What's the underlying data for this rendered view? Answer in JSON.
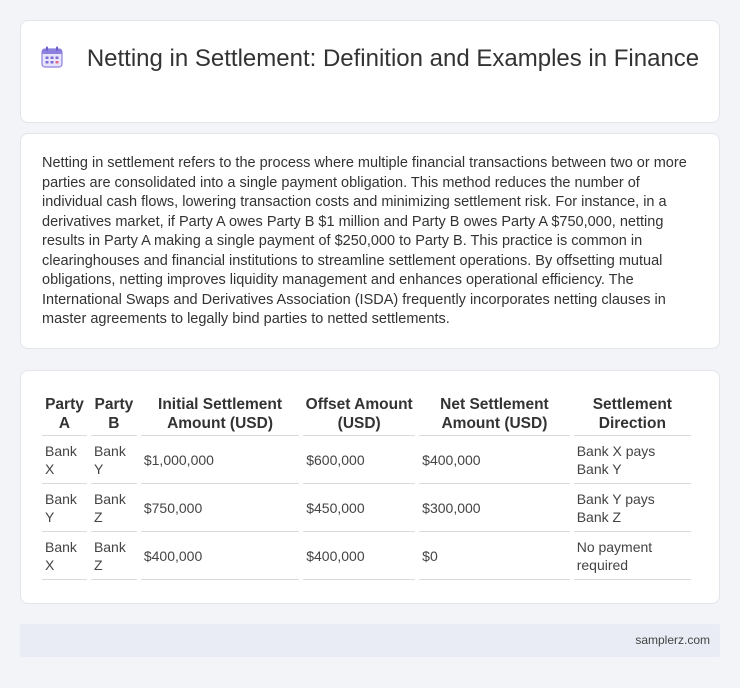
{
  "header": {
    "title": "Netting in Settlement: Definition and Examples in Finance",
    "icon": "calendar-icon",
    "icon_color": "#7b6fd6"
  },
  "description": {
    "text": "Netting in settlement refers to the process where multiple financial transactions between two or more parties are consolidated into a single payment obligation. This method reduces the number of individual cash flows, lowering transaction costs and minimizing settlement risk. For instance, in a derivatives market, if Party A owes Party B $1 million and Party B owes Party A $750,000, netting results in Party A making a single payment of $250,000 to Party B. This practice is common in clearinghouses and financial institutions to streamline settlement operations. By offsetting mutual obligations, netting improves liquidity management and enhances operational efficiency. The International Swaps and Derivatives Association (ISDA) frequently incorporates netting clauses in master agreements to legally bind parties to netted settlements."
  },
  "table": {
    "headers": [
      "Party A",
      "Party B",
      "Initial Settlement Amount (USD)",
      "Offset Amount (USD)",
      "Net Settlement Amount (USD)",
      "Settlement Direction"
    ],
    "rows": [
      [
        "Bank X",
        "Bank Y",
        "$1,000,000",
        "$600,000",
        "$400,000",
        "Bank X pays Bank Y"
      ],
      [
        "Bank Y",
        "Bank Z",
        "$750,000",
        "$450,000",
        "$300,000",
        "Bank Y pays Bank Z"
      ],
      [
        "Bank X",
        "Bank Z",
        "$400,000",
        "$400,000",
        "$0",
        "No payment required"
      ]
    ]
  },
  "footer": {
    "site": "samplerz.com"
  }
}
